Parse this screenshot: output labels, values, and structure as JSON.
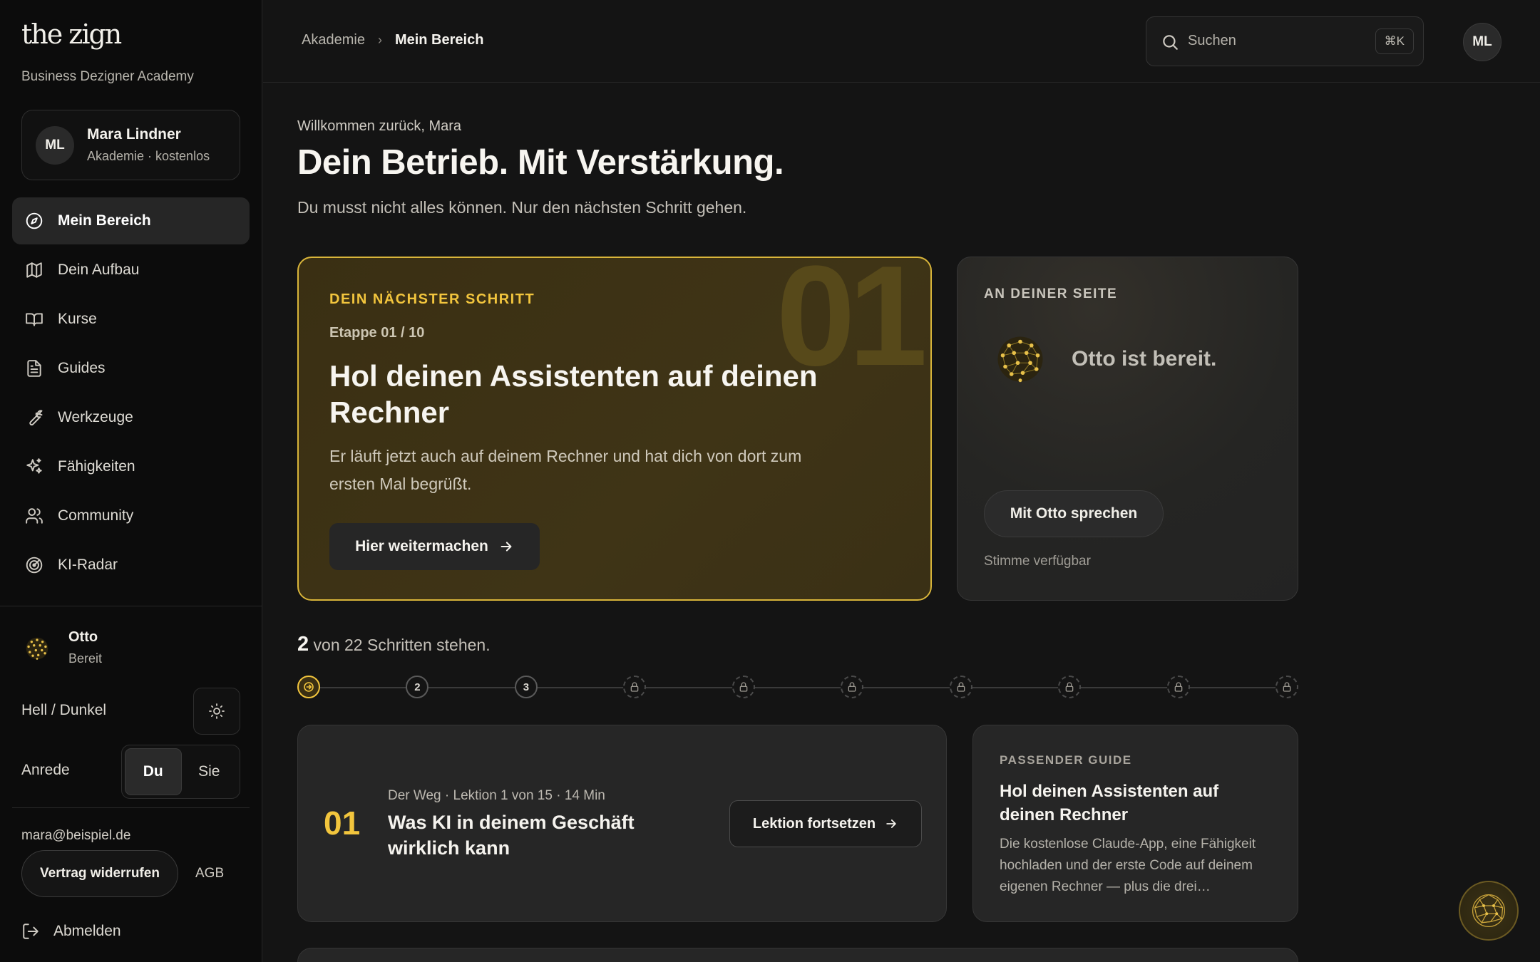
{
  "sidebar": {
    "logo": "the zign",
    "tagline": "Business Dezigner Academy",
    "user": {
      "initials": "ML",
      "name": "Mara Lindner",
      "plan": "Akademie · kostenlos"
    },
    "nav": [
      {
        "label": "Mein Bereich",
        "icon": "compass-icon",
        "active": true
      },
      {
        "label": "Dein Aufbau",
        "icon": "map-icon"
      },
      {
        "label": "Kurse",
        "icon": "book-icon"
      },
      {
        "label": "Guides",
        "icon": "document-icon"
      },
      {
        "label": "Werkzeuge",
        "icon": "wrench-icon"
      },
      {
        "label": "Fähigkeiten",
        "icon": "sparkles-icon"
      },
      {
        "label": "Community",
        "icon": "users-icon"
      },
      {
        "label": "KI-Radar",
        "icon": "radar-icon"
      }
    ],
    "assistant": {
      "name": "Otto",
      "status": "Bereit"
    },
    "theme_label": "Hell / Dunkel",
    "anrede": {
      "label": "Anrede",
      "options": [
        "Du",
        "Sie"
      ],
      "selected": "Du"
    },
    "email": "mara@beispiel.de",
    "revoke_label": "Vertrag widerrufen",
    "agb_label": "AGB",
    "logout_label": "Abmelden"
  },
  "topbar": {
    "breadcrumb": [
      "Akademie",
      "Mein Bereich"
    ],
    "breadcrumb_separator": "›",
    "search": {
      "placeholder": "Suchen",
      "shortcut": "⌘K"
    },
    "avatar_initials": "ML"
  },
  "main": {
    "welcome": "Willkommen zurück, Mara",
    "title": "Dein Betrieb. Mit Verstärkung.",
    "subtitle": "Du musst nicht alles können. Nur den nächsten Schritt gehen.",
    "next_step": {
      "kicker": "DEIN NÄCHSTER SCHRITT",
      "big_number": "01",
      "stage": "Etappe 01 / 10",
      "title": "Hol deinen Assistenten auf deinen Rechner",
      "description": "Er läuft jetzt auch auf deinem Rechner und hat dich von dort zum ersten Mal begrüßt.",
      "button": "Hier weitermachen"
    },
    "otto_card": {
      "kicker": "AN DEINER SEITE",
      "status": "Otto ist bereit.",
      "button": "Mit Otto sprechen",
      "note": "Stimme verfügbar"
    },
    "progress": {
      "done": "2",
      "text": "von 22 Schritten stehen.",
      "steps": [
        {
          "state": "current",
          "label": ""
        },
        {
          "state": "open",
          "label": "2"
        },
        {
          "state": "open",
          "label": "3"
        },
        {
          "state": "locked",
          "label": ""
        },
        {
          "state": "locked",
          "label": ""
        },
        {
          "state": "locked",
          "label": ""
        },
        {
          "state": "locked",
          "label": ""
        },
        {
          "state": "locked",
          "label": ""
        },
        {
          "state": "locked",
          "label": ""
        },
        {
          "state": "locked",
          "label": ""
        }
      ]
    },
    "lesson": {
      "number": "01",
      "meta": "Der Weg · Lektion 1 von 15 · 14 Min",
      "title": "Was KI in deinem Geschäft wirklich kann",
      "button": "Lektion fortsetzen"
    },
    "guide": {
      "kicker": "PASSENDER GUIDE",
      "title": "Hol deinen Assistenten auf deinen Rechner",
      "description": "Die kostenlose Claude-App, eine Fähigkeit hochladen und der erste Code auf deinem eigenen Rechner — plus die drei…"
    }
  },
  "colors": {
    "accent": "#f2c53d",
    "background": "#141414",
    "sidebar": "#0c0c0c",
    "card": "#262626"
  }
}
